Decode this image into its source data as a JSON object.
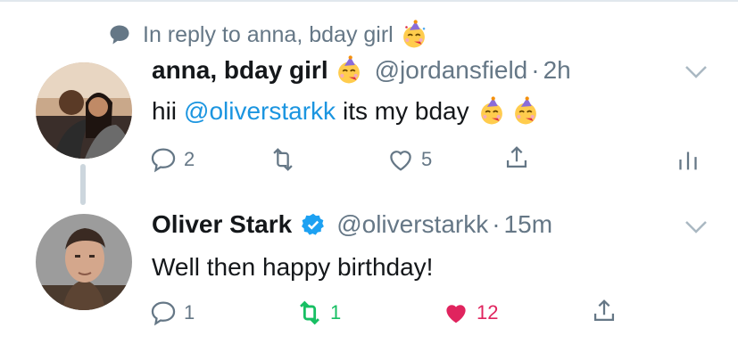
{
  "reply_context": {
    "text": "In reply to anna, bday girl",
    "emoji": "partying-face-emoji"
  },
  "tweets": [
    {
      "display_name": "anna, bday girl",
      "name_emoji": "partying-face-emoji",
      "handle": "@jordansfield",
      "separator": "·",
      "time": "2h",
      "text_before": "hii",
      "mention": "@oliverstarkk",
      "text_after": "its my bday",
      "text_emojis": [
        "partying-face-emoji",
        "partying-face-emoji"
      ],
      "replies": "2",
      "retweets": "",
      "likes": "5",
      "verified": false,
      "liked": false,
      "retweeted": false
    },
    {
      "display_name": "Oliver Stark",
      "handle": "@oliverstarkk",
      "separator": "·",
      "time": "15m",
      "text": "Well then happy birthday!",
      "replies": "1",
      "retweets": "1",
      "likes": "12",
      "verified": true,
      "liked": true,
      "retweeted": true
    }
  ],
  "colors": {
    "text": "#14171a",
    "secondary": "#657786",
    "link": "#1b95e0",
    "retweet": "#17bf63",
    "like": "#e0245e",
    "verified": "#1da1f2"
  }
}
